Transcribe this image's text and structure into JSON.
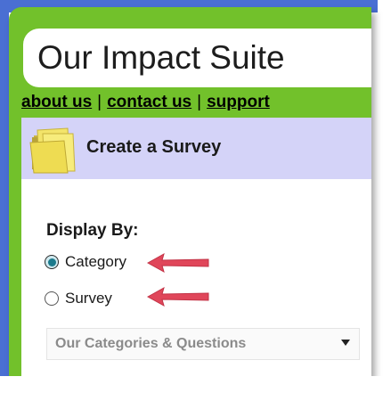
{
  "app": {
    "title": "Our Impact Suite"
  },
  "nav": {
    "items": [
      "about us",
      "contact us",
      "support"
    ],
    "separator": "|"
  },
  "panel": {
    "title": "Create a Survey",
    "icon": "folder-icon"
  },
  "display": {
    "label": "Display By:",
    "options": [
      {
        "label": "Category",
        "checked": true
      },
      {
        "label": "Survey",
        "checked": false
      }
    ]
  },
  "select": {
    "value": "Our Categories & Questions"
  },
  "colors": {
    "frame": "#72c12b",
    "edge": "#4a6fd3",
    "header": "#d4d3f8",
    "arrow": "#e0465a"
  }
}
